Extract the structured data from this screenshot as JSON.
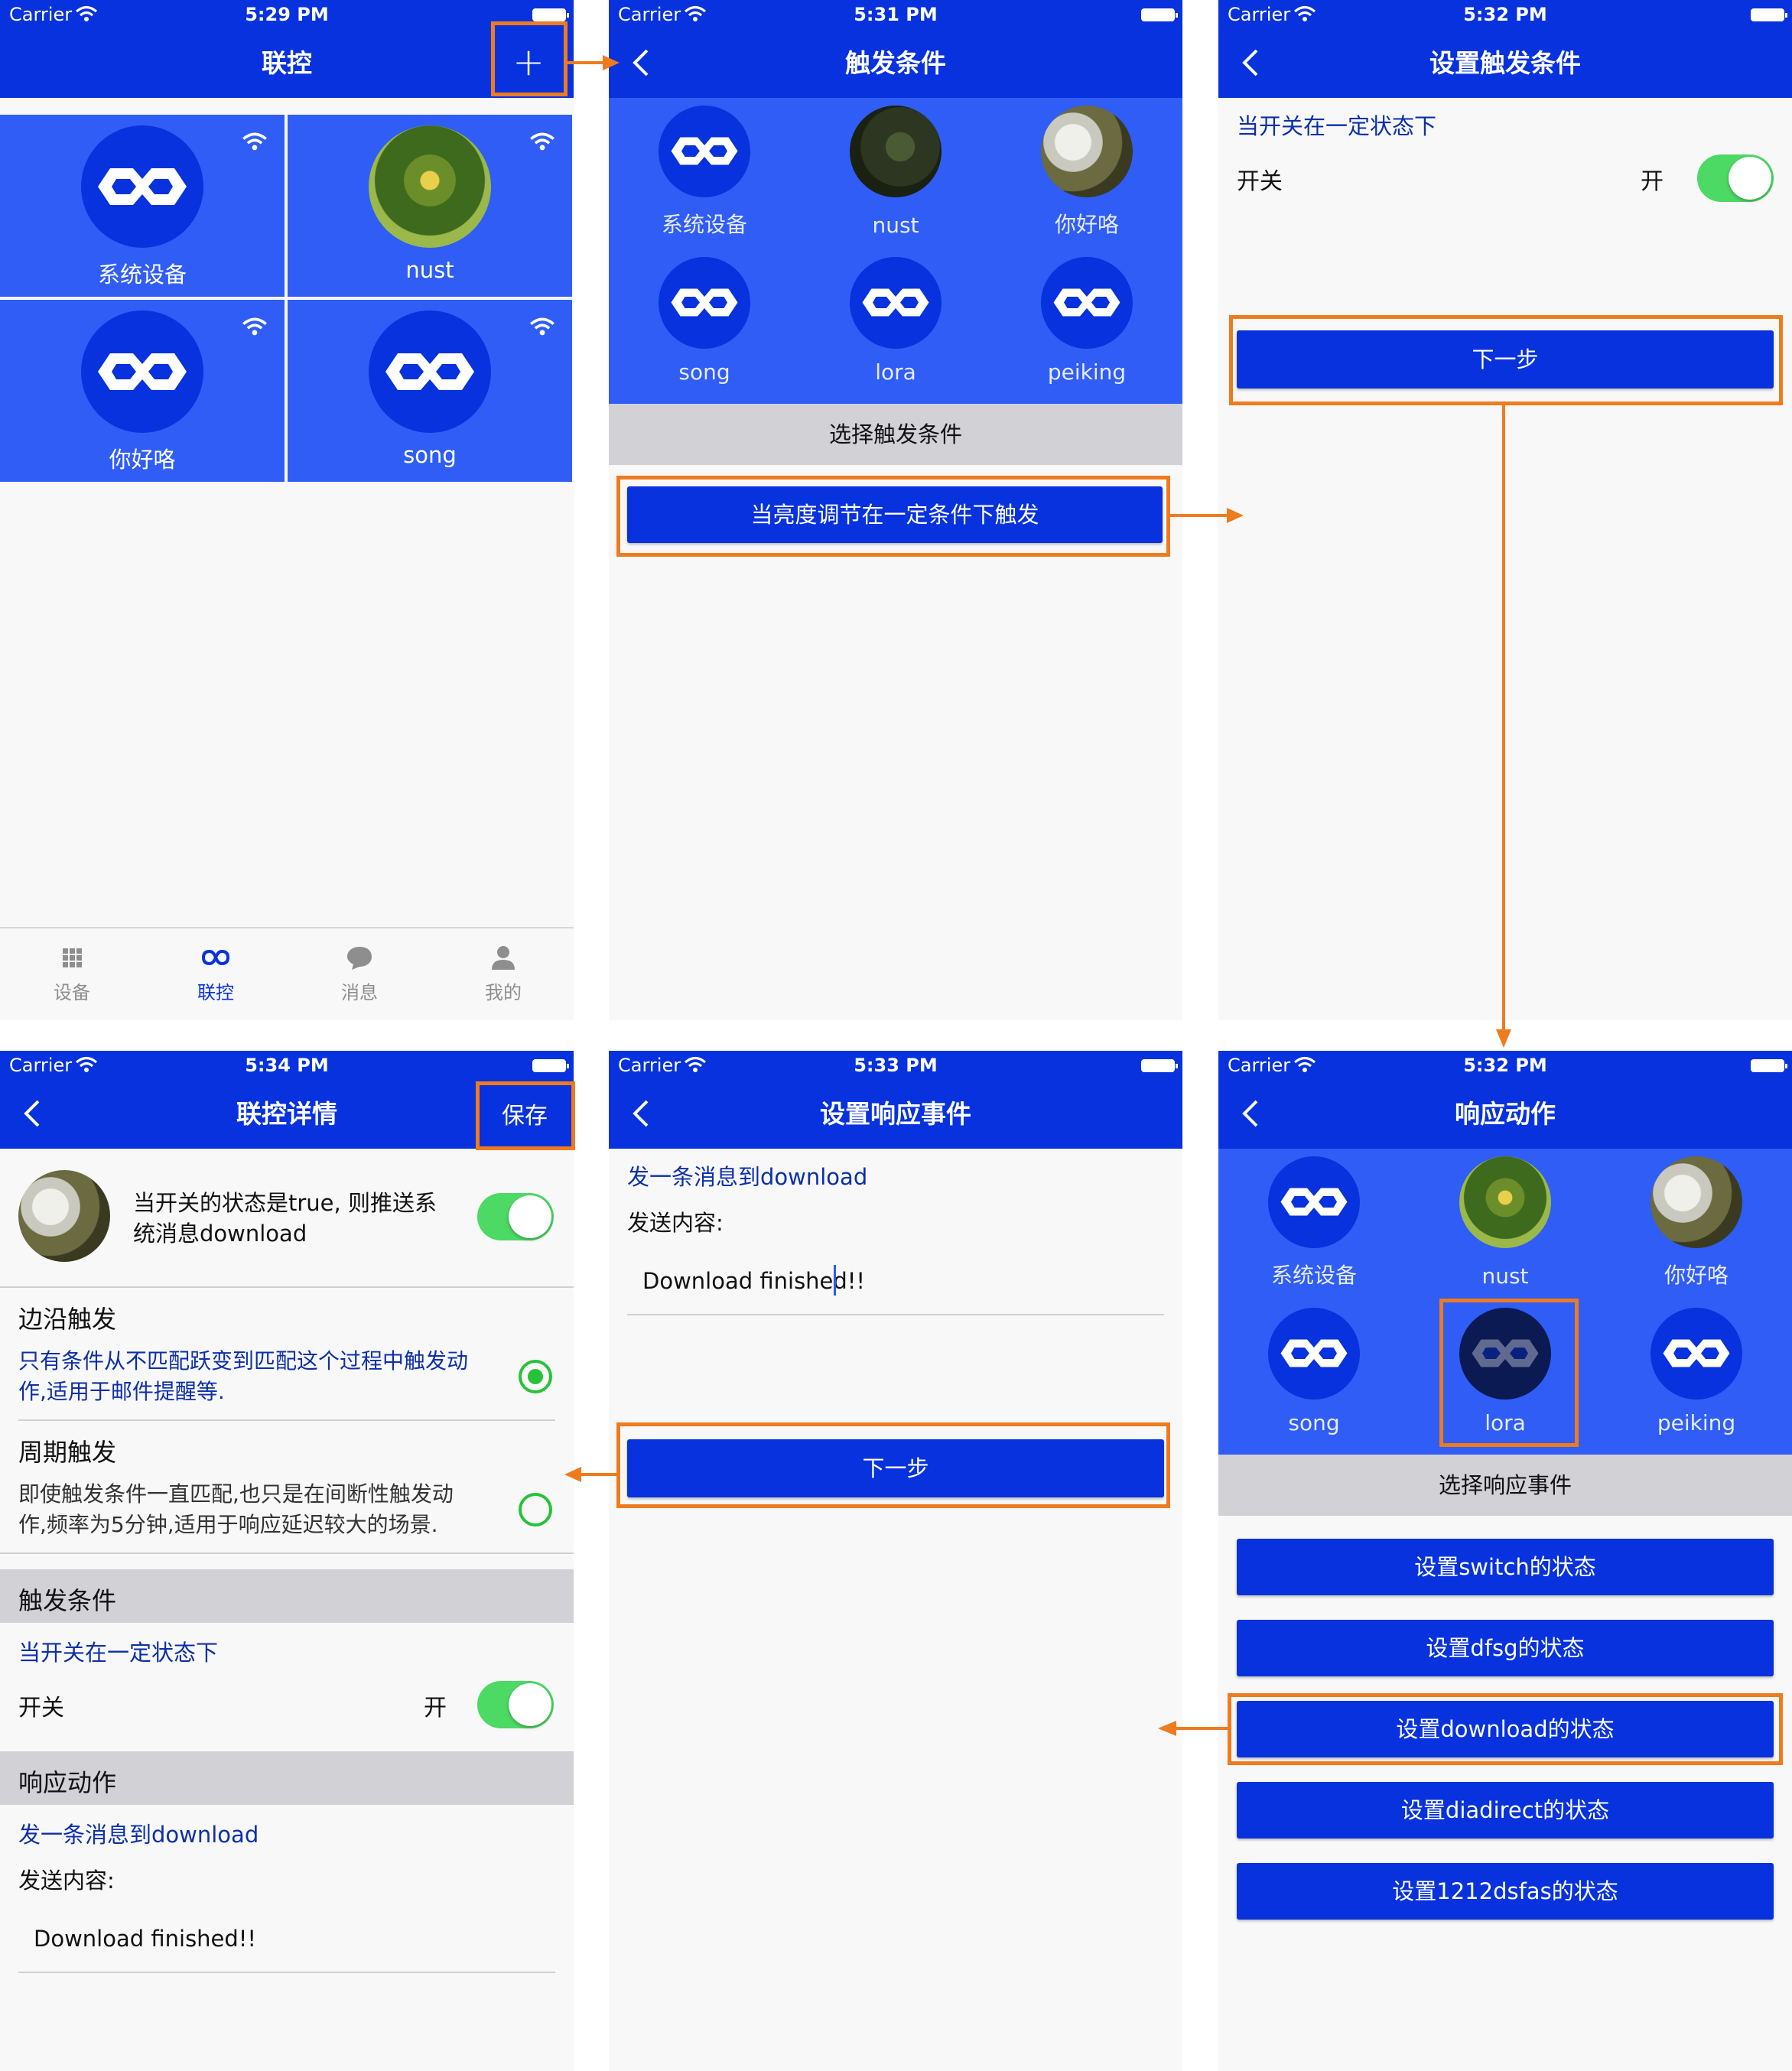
{
  "status": {
    "carrier": "Carrier",
    "times": [
      "5:29 PM",
      "5:31 PM",
      "5:32 PM",
      "5:34 PM",
      "5:33 PM",
      "5:32 PM"
    ]
  },
  "screen1": {
    "title": "联控",
    "tiles": [
      "系统设备",
      "nust",
      "你好咯",
      "song"
    ],
    "tabs": [
      "设备",
      "联控",
      "消息",
      "我的"
    ]
  },
  "screen2": {
    "title": "触发条件",
    "devices": [
      "系统设备",
      "nust",
      "你好咯",
      "song",
      "lora",
      "peiking"
    ],
    "section": "选择触发条件",
    "condition_button": "当亮度调节在一定条件下触发"
  },
  "screen3": {
    "title": "设置触发条件",
    "heading": "当开关在一定状态下",
    "switch_label": "开关",
    "switch_value": "开",
    "next_button": "下一步"
  },
  "screen4": {
    "title": "联控详情",
    "save": "保存",
    "summary": "当开关的状态是true, 则推送系统消息download",
    "summary_line1": "当开关的状态是true, 则推送系",
    "summary_line2": "统消息download",
    "edge_title": "边沿触发",
    "edge_desc_line1": "只有条件从不匹配跃变到匹配这个过程中触发动",
    "edge_desc_line2": "作,适用于邮件提醒等.",
    "period_title": "周期触发",
    "period_desc_line1": "即使触发条件一直匹配,也只是在间断性触发动",
    "period_desc_line2": "作,频率为5分钟,适用于响应延迟较大的场景.",
    "trigger_section": "触发条件",
    "trigger_heading": "当开关在一定状态下",
    "switch_label": "开关",
    "switch_value": "开",
    "response_section": "响应动作",
    "response_heading": "发一条消息到download",
    "send_label": "发送内容:",
    "send_value": "Download finished!!"
  },
  "screen5": {
    "title": "设置响应事件",
    "heading": "发一条消息到download",
    "send_label": "发送内容:",
    "send_value": "Download finished!!",
    "next_button": "下一步"
  },
  "screen6": {
    "title": "响应动作",
    "devices": [
      "系统设备",
      "nust",
      "你好咯",
      "song",
      "lora",
      "peiking"
    ],
    "section": "选择响应事件",
    "actions": [
      "设置switch的状态",
      "设置dfsg的状态",
      "设置download的状态",
      "设置diadirect的状态",
      "设置1212dsfas的状态"
    ]
  },
  "colors": {
    "primary": "#0732dd",
    "tile_blue": "#2f5df6",
    "highlight": "#ef7b1f",
    "toggle_on": "#4cd964"
  }
}
